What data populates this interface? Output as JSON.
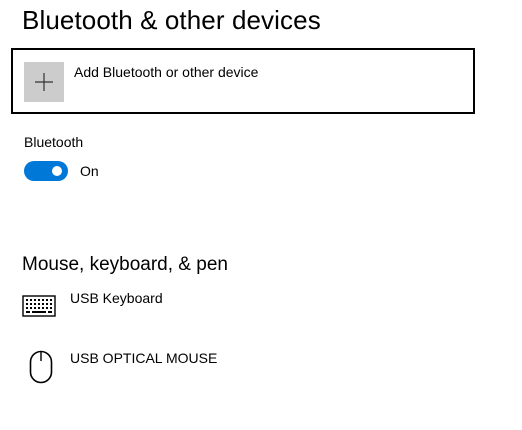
{
  "page": {
    "title": "Bluetooth & other devices"
  },
  "add_device": {
    "label": "Add Bluetooth or other device",
    "icon": "plus-icon"
  },
  "bluetooth": {
    "label": "Bluetooth",
    "state": "On",
    "enabled": true
  },
  "colors": {
    "accent": "#0078d7",
    "tile": "#cccccc"
  },
  "section": {
    "title": "Mouse, keyboard, & pen",
    "devices": [
      {
        "name": "USB Keyboard",
        "icon": "keyboard-icon"
      },
      {
        "name": "USB OPTICAL MOUSE",
        "icon": "mouse-icon"
      }
    ]
  }
}
